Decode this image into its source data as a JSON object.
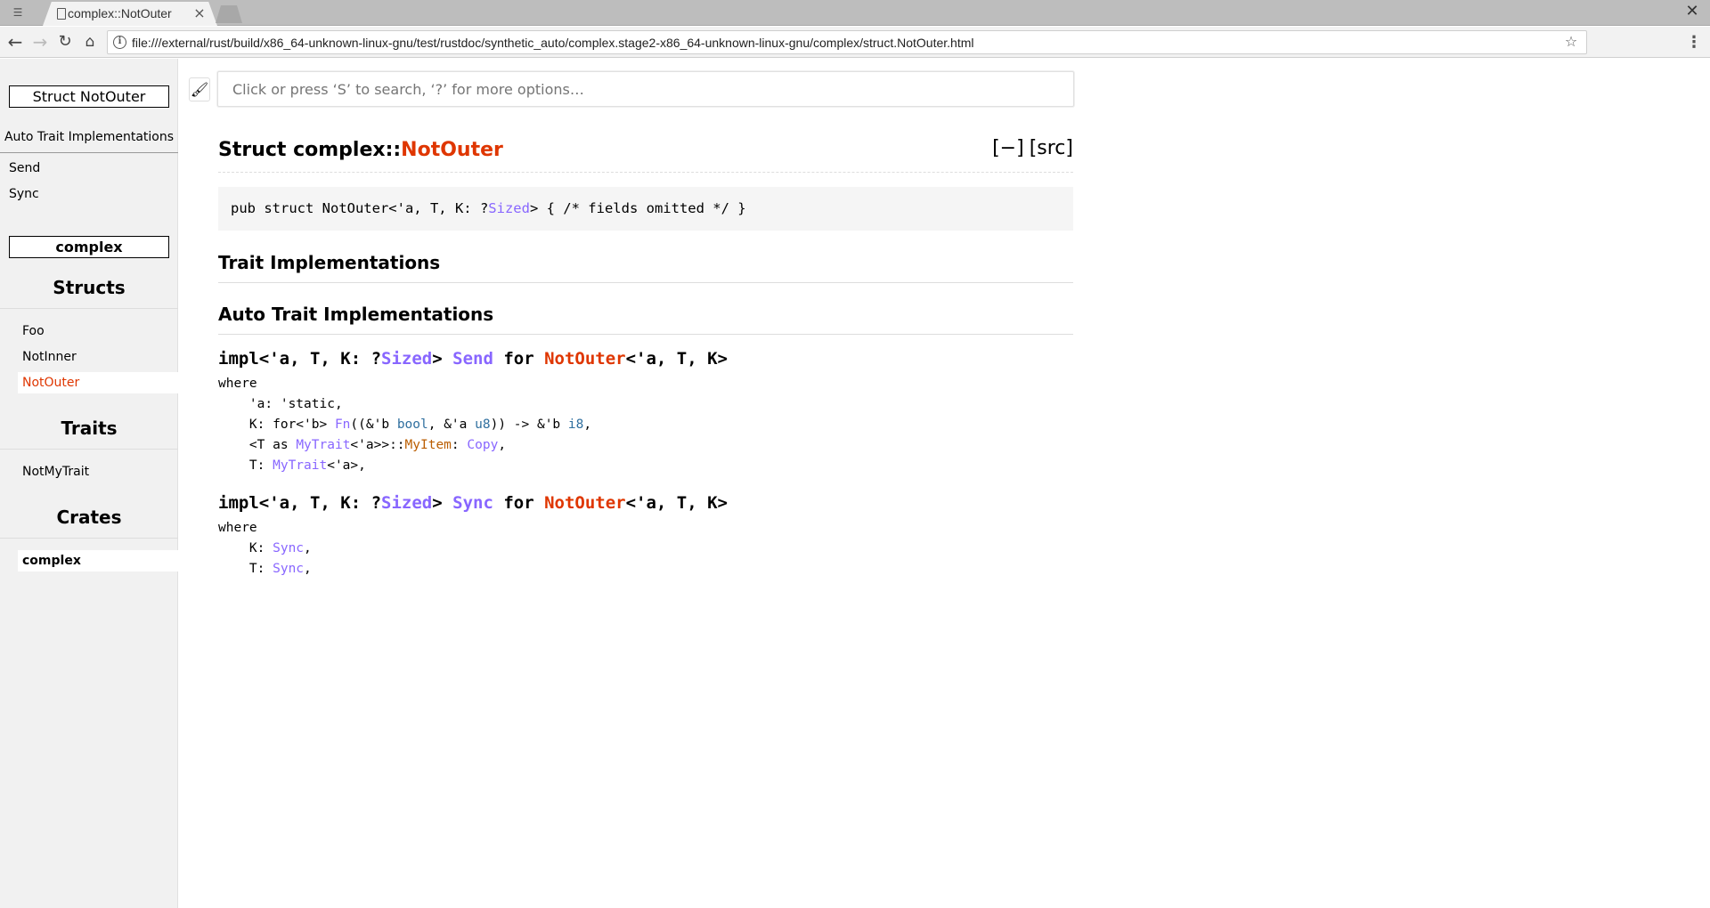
{
  "browser": {
    "tab_title": "complex::NotOuter",
    "url": "file:///external/rust/build/x86_64-unknown-linux-gnu/test/rustdoc/synthetic_auto/complex.stage2-x86_64-unknown-linux-gnu/complex/struct.NotOuter.html",
    "icons": [
      "tab-search-icon",
      "document-icon",
      "close-icon",
      "back-icon",
      "forward-icon",
      "reload-icon",
      "home-icon",
      "info-icon",
      "star-icon",
      "menu-icon"
    ]
  },
  "sidebar": {
    "location": "Struct NotOuter",
    "block_title": "Auto Trait Implementations",
    "block_links": [
      "Send",
      "Sync"
    ],
    "crate_box": "complex",
    "structs_heading": "Structs",
    "structs": [
      "Foo",
      "NotInner",
      "NotOuter"
    ],
    "traits_heading": "Traits",
    "traits": [
      "NotMyTrait"
    ],
    "crates_heading": "Crates",
    "crates": [
      "complex"
    ]
  },
  "search": {
    "placeholder": "Click or press ‘S’ to search, ‘?’ for more options…"
  },
  "main": {
    "title_prefix": "Struct complex::",
    "title_name": "NotOuter",
    "collapse_toggle": "[−]",
    "src_link": "[src]",
    "decl": {
      "before": "pub struct NotOuter<'a, T, K: ?",
      "sized": "Sized",
      "after": "> { /* fields omitted */ }"
    },
    "trait_impls_heading": "Trait Implementations",
    "auto_trait_impls_heading": "Auto Trait Implementations",
    "impl_send": {
      "prefix": "impl<'a, T, K: ?",
      "sized": "Sized",
      "mid": "> ",
      "trait": "Send",
      "for": " for ",
      "struct": "NotOuter",
      "suffix": "<'a, T, K>",
      "where": "where",
      "line1": "    'a: 'static,",
      "line2_a": "    K: for<'b> ",
      "line2_fn": "Fn",
      "line2_b": "((&'b ",
      "line2_bool": "bool",
      "line2_c": ", &'a ",
      "line2_u8": "u8",
      "line2_d": ")) -> &'b ",
      "line2_i8": "i8",
      "line2_e": ",",
      "line3_a": "    <T as ",
      "line3_mytrait": "MyTrait",
      "line3_b": "<'a>>::",
      "line3_myitem": "MyItem",
      "line3_c": ": ",
      "line3_copy": "Copy",
      "line3_d": ",",
      "line4_a": "    T: ",
      "line4_mytrait": "MyTrait",
      "line4_b": "<'a>,"
    },
    "impl_sync": {
      "prefix": "impl<'a, T, K: ?",
      "sized": "Sized",
      "mid": "> ",
      "trait": "Sync",
      "for": " for ",
      "struct": "NotOuter",
      "suffix": "<'a, T, K>",
      "where": "where",
      "line1_a": "    K: ",
      "line1_sync": "Sync",
      "line1_b": ",",
      "line2_a": "    T: ",
      "line2_sync": "Sync",
      "line2_b": ","
    }
  }
}
